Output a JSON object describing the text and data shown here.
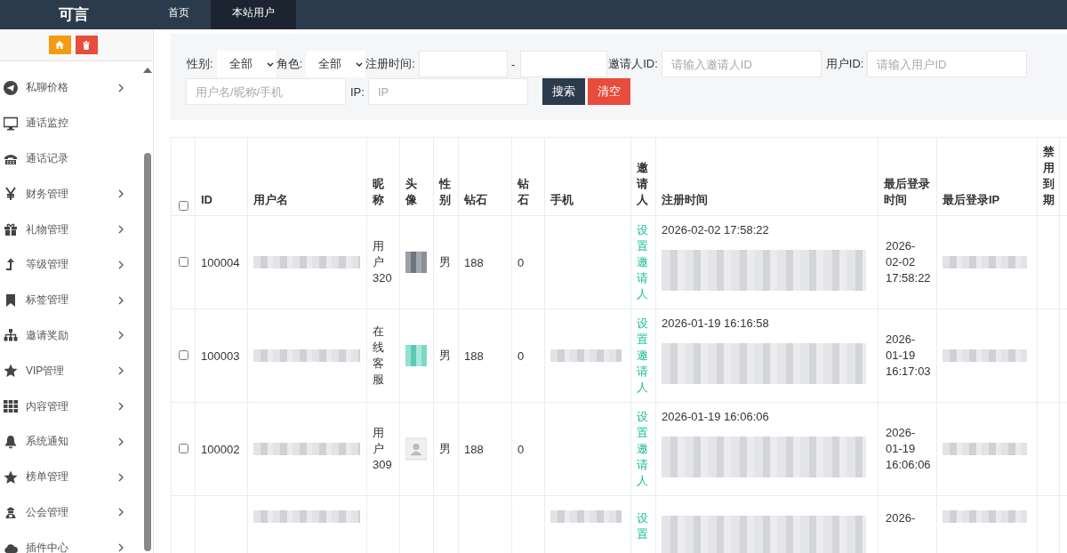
{
  "header": {
    "logo": "可言",
    "nav": [
      {
        "label": "首页",
        "selected": false
      },
      {
        "label": "本站用户",
        "selected": true
      }
    ]
  },
  "sidebar": {
    "items": [
      {
        "label": "私聊价格",
        "has_arrow": true
      },
      {
        "label": "通话监控",
        "has_arrow": false
      },
      {
        "label": "通话记录",
        "has_arrow": false
      },
      {
        "label": "财务管理",
        "has_arrow": true
      },
      {
        "label": "礼物管理",
        "has_arrow": true
      },
      {
        "label": "等级管理",
        "has_arrow": true
      },
      {
        "label": "标签管理",
        "has_arrow": true
      },
      {
        "label": "邀请奖励",
        "has_arrow": true
      },
      {
        "label": "VIP管理",
        "has_arrow": true
      },
      {
        "label": "内容管理",
        "has_arrow": true
      },
      {
        "label": "系统通知",
        "has_arrow": true
      },
      {
        "label": "榜单管理",
        "has_arrow": true
      },
      {
        "label": "公会管理",
        "has_arrow": true
      },
      {
        "label": "插件中心",
        "has_arrow": true
      }
    ]
  },
  "filters": {
    "gender_label": "性别:",
    "gender_value": "全部",
    "role_label": "角色:",
    "role_value": "全部",
    "reg_time_label": "注册时间:",
    "range_sep": "-",
    "inviter_label": "邀请人ID:",
    "inviter_placeholder": "请输入邀请人ID",
    "user_id_label": "用户ID:",
    "user_id_placeholder": "请输入用户ID",
    "keyword_placeholder": "用户名/昵称/手机",
    "ip_label": "IP:",
    "ip_placeholder": "IP",
    "search_button": "搜索",
    "clear_button": "清空"
  },
  "table": {
    "select_all_checked": false,
    "columns": [
      "ID",
      "用户名",
      "昵称",
      "头像",
      "性别",
      "钻石",
      "钻石",
      "手机",
      "邀请人",
      "注册时间",
      "最后登录时间",
      "最后登录IP",
      "禁用到期"
    ],
    "rows": [
      {
        "checked": false,
        "id": "100004",
        "username_blurred": true,
        "nickname": "用户320",
        "gender": "男",
        "diamonds": "188",
        "diamonds_2": "0",
        "phone_blurred": false,
        "invite": "设置邀请人",
        "reg_time": "2026-02-02 17:58:22",
        "reg_extra_blurred": true,
        "last_login": "2026-02-02 17:58:22",
        "ip_blurred": true
      },
      {
        "checked": false,
        "id": "100003",
        "username_blurred": true,
        "nickname": "在线客服",
        "gender": "男",
        "diamonds": "188",
        "diamonds_2": "0",
        "phone_blurred": true,
        "invite": "设置邀请人",
        "reg_time": "2026-01-19 16:16:58",
        "reg_extra_blurred": true,
        "last_login": "2026-01-19 16:17:03",
        "ip_blurred": true
      },
      {
        "checked": false,
        "id": "100002",
        "username_blurred": true,
        "nickname": "用户309",
        "gender": "男",
        "diamonds": "188",
        "diamonds_2": "0",
        "phone_blurred": false,
        "invite": "设置邀请人",
        "reg_time": "2026-01-19 16:06:06",
        "reg_extra_blurred": true,
        "last_login": "2026-01-19 16:06:06",
        "ip_blurred": true
      },
      {
        "partial": true,
        "username_blurred": true,
        "phone_blurred": true,
        "invite": "设置",
        "reg_extra_blurred": true,
        "last_login": "2026-",
        "ip_blurred": true
      }
    ]
  }
}
